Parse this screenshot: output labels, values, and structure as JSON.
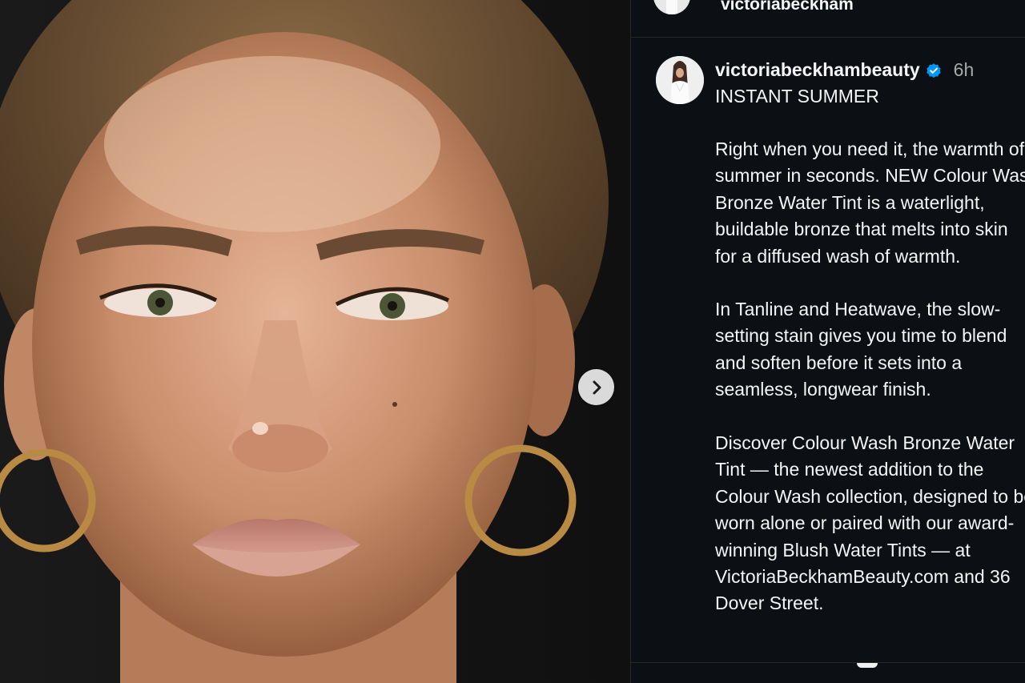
{
  "post": {
    "header_username": "victoriabeckham",
    "next_icon": "chevron-right-icon"
  },
  "caption": {
    "username": "victoriabeckhambeauty",
    "verified_icon": "verified-badge-icon",
    "time": "6h",
    "title": "INSTANT SUMMER",
    "p1": "Right when you need it, the warmth of\nsummer in seconds. NEW Colour Wash\nBronze Water Tint is a waterlight,\nbuildable bronze that melts into skin\nfor a diffused wash of warmth.",
    "p2": "In Tanline and Heatwave, the slow-\nsetting stain gives you time to blend\nand soften before it sets into a\nseamless, longwear finish.",
    "p3": "Discover Colour Wash Bronze Water\nTint — the newest addition to the\nColour Wash collection, designed to be\nworn alone or paired with our award-\nwinning Blush Water Tints — at\nVictoriaBeckhamBeauty.com and 36\nDover Street."
  },
  "colors": {
    "background": "#0c1014",
    "text": "#f5f5f5",
    "muted": "#a8a8a8",
    "verified": "#0095f6"
  }
}
